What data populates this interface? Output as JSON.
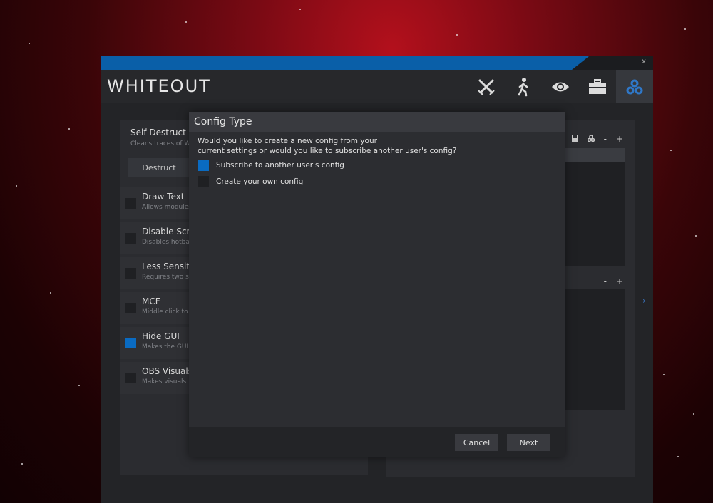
{
  "app": {
    "title": "WHITEOUT",
    "close_label": "x"
  },
  "nav": [
    {
      "name": "combat-icon",
      "active": false
    },
    {
      "name": "movement-icon",
      "active": false
    },
    {
      "name": "visuals-icon",
      "active": false
    },
    {
      "name": "misc-icon",
      "active": false
    },
    {
      "name": "config-icon",
      "active": true
    }
  ],
  "left_panel": {
    "title": "Self Destruct",
    "subtitle": "Cleans traces of W",
    "destruct_label": "Destruct",
    "settings": [
      {
        "label": "Draw Text",
        "desc": "Allows modules",
        "checked": false
      },
      {
        "label": "Disable Scro",
        "desc": "Disables hotba",
        "checked": false
      },
      {
        "label": "Less Sensiti",
        "desc": "Requires two s",
        "checked": false
      },
      {
        "label": "MCF",
        "desc": "Middle click to",
        "checked": false
      },
      {
        "label": "Hide GUI",
        "desc": "Makes the GUI",
        "checked": true
      },
      {
        "label": "OBS Visuals",
        "desc": "Makes visuals",
        "checked": false
      }
    ]
  },
  "right_panel": {
    "minus": "-",
    "plus": "+"
  },
  "modal": {
    "title": "Config Type",
    "question_line1": "Would you like to create a new config from your",
    "question_line2": "current settings or would you like to subscribe another user's config?",
    "options": [
      {
        "label": "Subscribe to another user's config",
        "checked": true
      },
      {
        "label": "Create your own config",
        "checked": false
      }
    ],
    "cancel_label": "Cancel",
    "next_label": "Next"
  },
  "colors": {
    "accent": "#0a6bc2",
    "titlebar": "#0a5fa8",
    "background_red": "#b3101c"
  }
}
